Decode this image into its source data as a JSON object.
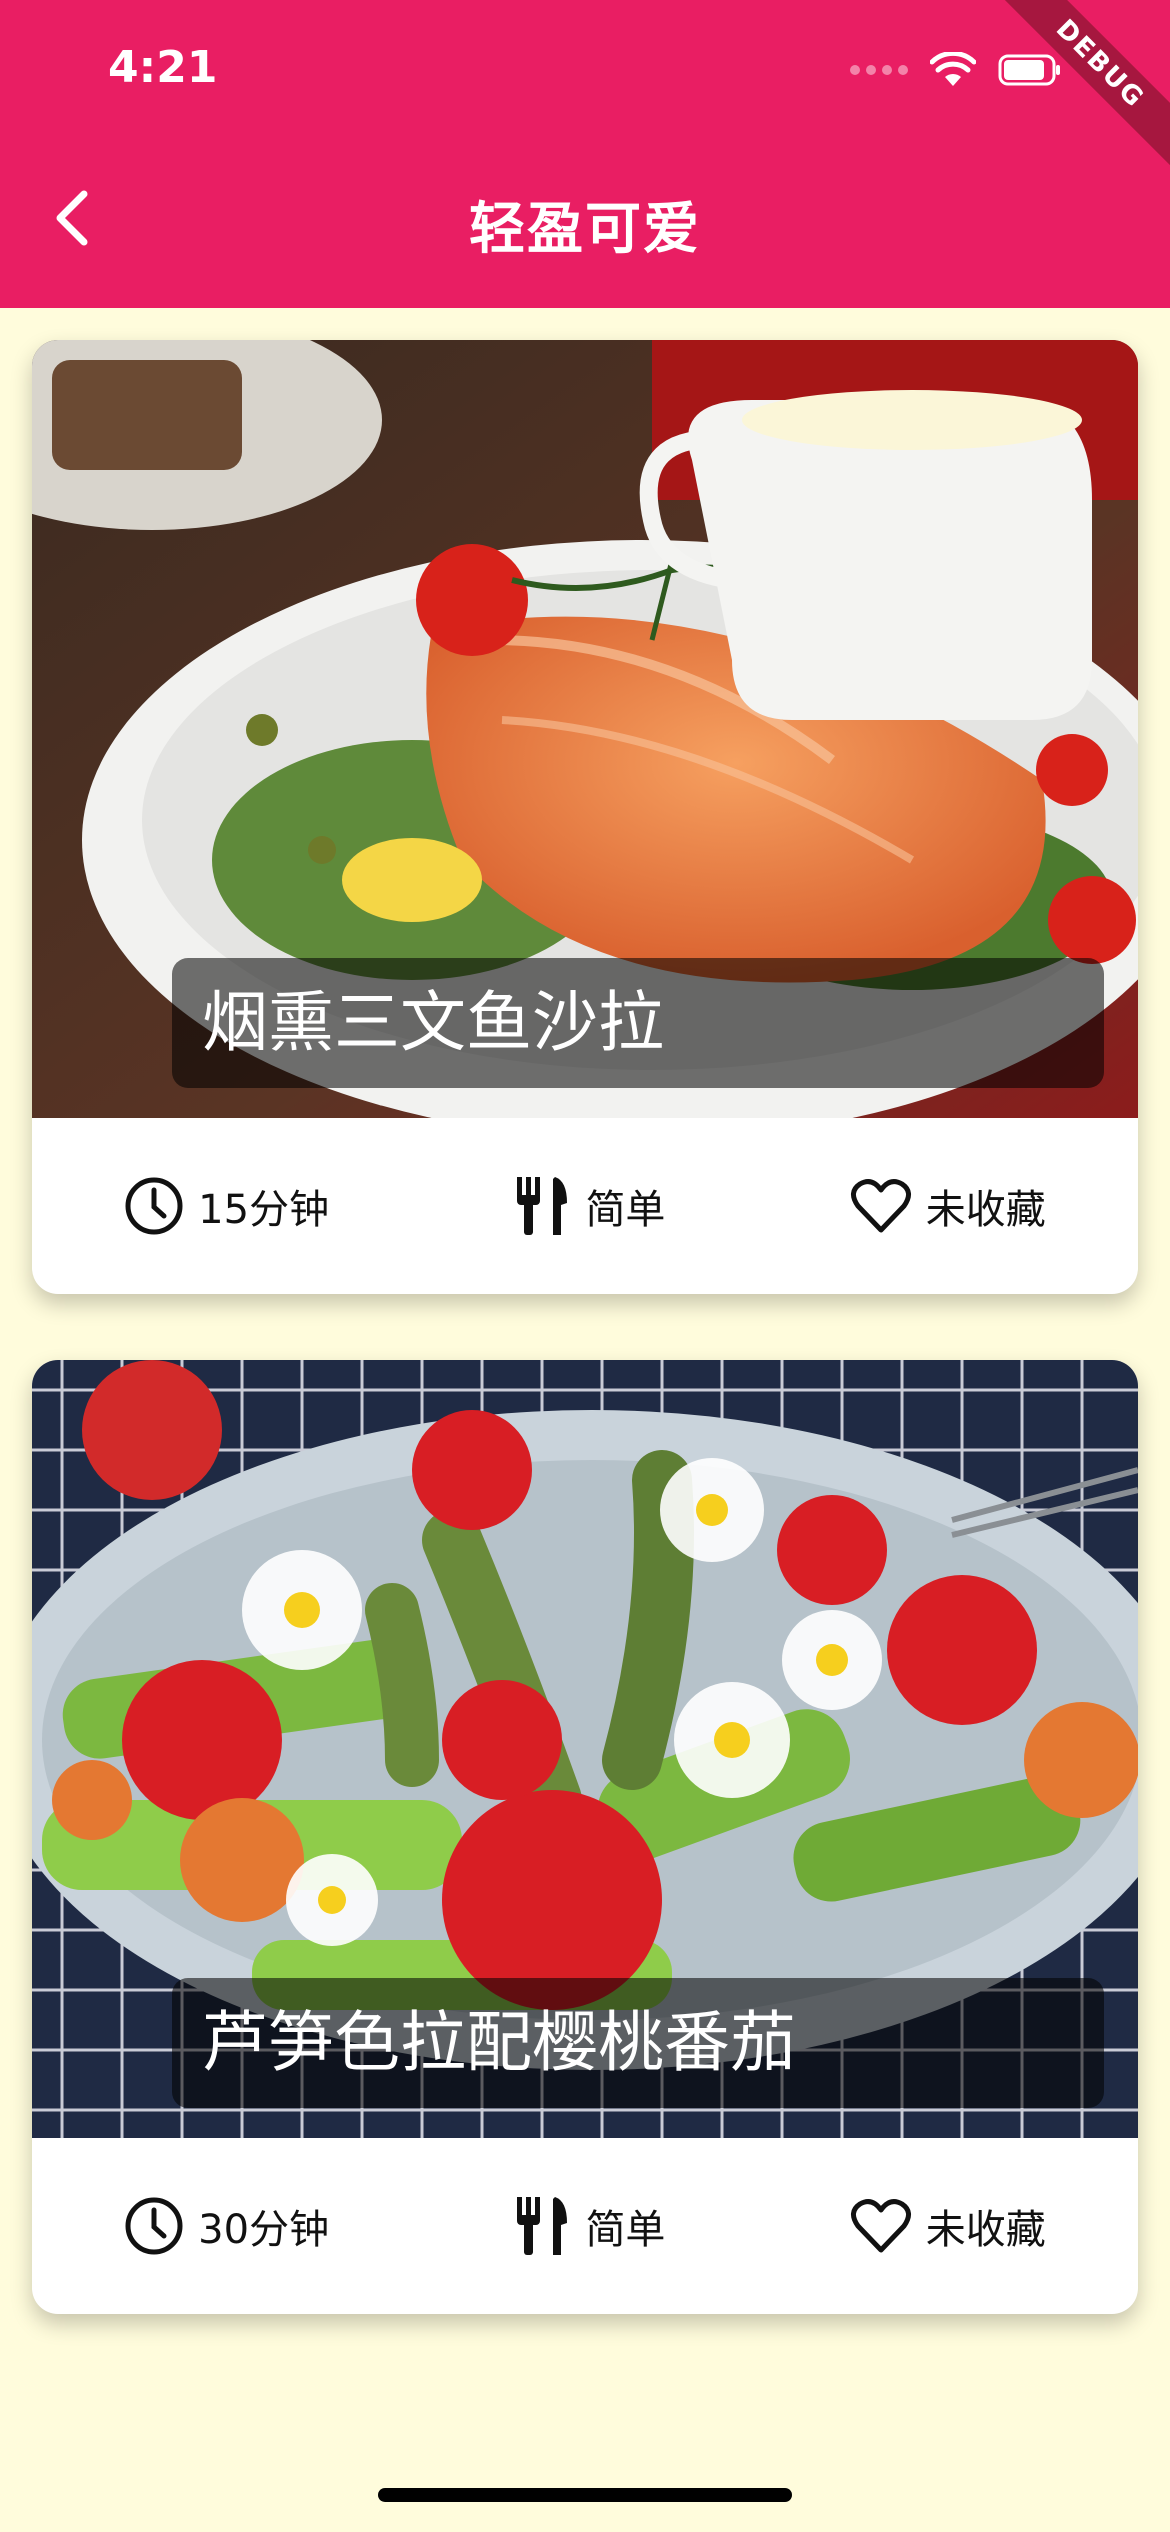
{
  "status": {
    "time": "4:21",
    "debug_label": "DEBUG"
  },
  "appbar": {
    "title": "轻盈可爱",
    "back_icon": "chevron-left-icon",
    "color": "#e91e63"
  },
  "meals": [
    {
      "title": "烟熏三文鱼沙拉",
      "duration": "15分钟",
      "complexity": "简单",
      "favorite": "未收藏"
    },
    {
      "title": "芦笋色拉配樱桃番茄",
      "duration": "30分钟",
      "complexity": "简单",
      "favorite": "未收藏"
    }
  ],
  "theme": {
    "background": "#fffcdc",
    "accent": "#e91e63"
  }
}
